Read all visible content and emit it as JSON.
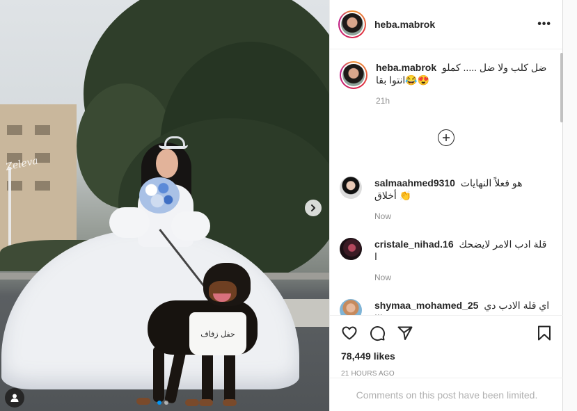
{
  "post": {
    "username": "heba.mabrok",
    "more_label": "•••",
    "caption_line1": "ضل كلب ولا ضل ..... كملو",
    "caption_line2": "انتوا بقا😂😍",
    "caption_time": "21h",
    "likes": "78,449 likes",
    "time_ago": "21 HOURS AGO",
    "comments_limited": "Comments on this post have been limited.",
    "carousel": {
      "slides": 2,
      "active_slide": 1
    }
  },
  "photo": {
    "watermark": "Zeleva",
    "sign_text": "حفل زفاف"
  },
  "comments": [
    {
      "username": "salmaahmed9310",
      "text_line1": "هو فعلاً النهايات",
      "text_line2": "أخلاق 👏",
      "time": "Now"
    },
    {
      "username": "cristale_nihad.16",
      "text_line1": "قلة ادب الامر لايضحك",
      "text_line2": "ا",
      "time": "Now"
    },
    {
      "username": "shymaa_mohamed_25",
      "text_line1": "اي قلة الادب دي",
      "text_line2": "!!!",
      "time": ""
    }
  ],
  "icons": {
    "like": "heart-icon",
    "comment": "comment-icon",
    "share": "paper-plane-icon",
    "save": "bookmark-icon",
    "more": "more-options-icon",
    "load_more": "plus-circle-icon",
    "next": "chevron-right-icon",
    "tag": "user-tag-icon"
  },
  "colors": {
    "text": "#262626",
    "muted": "#8e8e8e",
    "carousel_active": "#0095f6",
    "border": "#efefef"
  }
}
